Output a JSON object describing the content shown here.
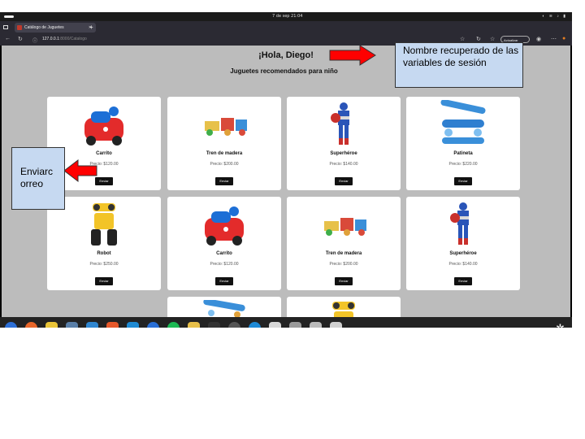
{
  "system": {
    "clock": "7 de sep  21:04"
  },
  "browser": {
    "tab_title": "Catálogo de Juguetes",
    "url_host": "127.0.0.1",
    "url_rest": ":8000/Catalogo",
    "update_label": "Actualizar"
  },
  "page": {
    "greeting": "¡Hola, Diego!",
    "subtitle": "Juguetes recomendados para niño",
    "send_label": "Enviar",
    "products": [
      {
        "name": "Carrito",
        "price": "Precio: $120.00",
        "icon": "red-car"
      },
      {
        "name": "Tren de madera",
        "price": "Precio: $200.00",
        "icon": "wooden-train"
      },
      {
        "name": "Superhéroe",
        "price": "Precio: $140.00",
        "icon": "superhero-figure"
      },
      {
        "name": "Patineta",
        "price": "Precio: $220.00",
        "icon": "blue-skateboard"
      },
      {
        "name": "Robot",
        "price": "Precio: $250.00",
        "icon": "yellow-robot"
      },
      {
        "name": "Carrito",
        "price": "Precio: $120.00",
        "icon": "red-car"
      },
      {
        "name": "Tren de madera",
        "price": "Precio: $200.00",
        "icon": "wooden-train"
      },
      {
        "name": "Superhéroe",
        "price": "Precio: $140.00",
        "icon": "superhero-figure"
      },
      {
        "name": "",
        "price": "",
        "icon": "blue-skateboard"
      },
      {
        "name": "",
        "price": "",
        "icon": "yellow-robot"
      }
    ]
  },
  "annotations": {
    "session_note": "Nombre recuperado de las variables de sesión",
    "email_note": "Enviarc orreo",
    "box_color": "#c6d9f1",
    "arrow_color": "#ff0000"
  },
  "colors": {
    "page_bg": "#bcbcbc",
    "card_bg": "#ffffff",
    "button_bg": "#111111"
  }
}
